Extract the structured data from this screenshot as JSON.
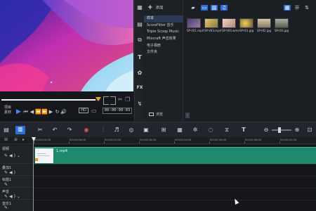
{
  "player": {
    "mode_labels": [
      "项目",
      "素材"
    ],
    "timecode": "00:00:00:03",
    "hd_label": "HD",
    "icons": [
      "mark-in-icon",
      "mark-out-icon",
      "split-icon",
      "copy-icon",
      "play-icon",
      "prev-icon",
      "rewind-icon",
      "step-back-icon",
      "step-forward-icon",
      "fast-forward-icon",
      "loop-icon",
      "volume-icon"
    ]
  },
  "library": {
    "add_label": "添加",
    "browse_label": "浏览",
    "nav_items": [
      "样本",
      "ScoreFitter 音乐",
      "Triple Scoop Music",
      "Mixcraft 声音效果",
      "电子相册",
      "文件夹"
    ],
    "side_icons": [
      "media-icon",
      "instant-project-icon",
      "transition-icon",
      "title-icon",
      "graphic-icon",
      "fx-icon",
      "path-icon"
    ],
    "toolbar_icons": [
      "folder-icon",
      "video-filter-icon",
      "photo-filter-icon",
      "audio-filter-icon",
      "grid-view-icon",
      "list-view-icon",
      "sort-icon"
    ],
    "thumbnails": [
      {
        "caption": "SP-V01.mp4",
        "color": "#7a6b8f"
      },
      {
        "caption": "SP-V03.mp4",
        "color": "#c8b25a"
      },
      {
        "caption": "SP-V04.wmv",
        "color": "#d9b7a0"
      },
      {
        "caption": "SP-I01.jpg",
        "color": "#b59a4a"
      },
      {
        "caption": "SP-I02.jpg",
        "color": "#c8b89a"
      },
      {
        "caption": "SP-I03.jpg",
        "color": "#8a8f7a"
      }
    ]
  },
  "toolbar": {
    "tools": [
      "storyboard-icon",
      "timeline-icon",
      "tools-icon",
      "undo-icon",
      "redo-icon",
      "record-icon",
      "audio-mix-icon",
      "auto-music-icon",
      "motion-track-icon",
      "subtitle-icon",
      "multicam-icon",
      "split-screen-icon",
      "mask-icon",
      "stop-motion-icon",
      "speed-icon",
      "title-icon"
    ],
    "zoom_out_icon": "zoom-out-icon",
    "zoom_in_icon": "zoom-in-icon"
  },
  "ruler": {
    "labels": [
      "00:00:00:00",
      "00:00:06:00",
      "00:00:12:00",
      "00:00:18:00",
      "00:00:24:00",
      "00:00:30:00",
      "00:00:36:00",
      "00:00:42:00"
    ]
  },
  "tracks": {
    "names": [
      "视频",
      "叠加1",
      "标题1",
      "声音",
      "音乐1"
    ],
    "clip_label": "1.mp4"
  },
  "colors": {
    "accent": "#2d6fd6",
    "clip": "#1e8a6d",
    "playhead": "#f2f2f2"
  }
}
